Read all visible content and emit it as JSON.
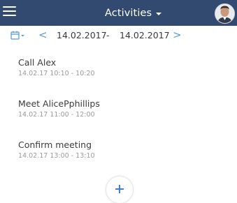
{
  "header": {
    "title": "Activities",
    "background": "#334a70"
  },
  "icons": {
    "menu": "hamburger-menu-icon",
    "title_dropdown": "caret-down-icon",
    "avatar": "user-avatar",
    "calendar": "calendar-icon",
    "prev": "chevron-left-icon",
    "next": "chevron-right-icon",
    "add": "plus-icon"
  },
  "date_filter": {
    "start": "14.02.2017",
    "separator": "-",
    "end": "14.02.2017",
    "prev_glyph": "<",
    "next_glyph": ">",
    "accent": "#5b9bd8"
  },
  "activities": [
    {
      "title": "Call Alex",
      "time": "14.02.17 10:10 - 10:20"
    },
    {
      "title": "Meet AlicePphillips",
      "time": "14.02.17 11:00 - 12:00"
    },
    {
      "title": "Confirm meeting",
      "time": "14.02.17 13:00 - 13:10"
    }
  ]
}
